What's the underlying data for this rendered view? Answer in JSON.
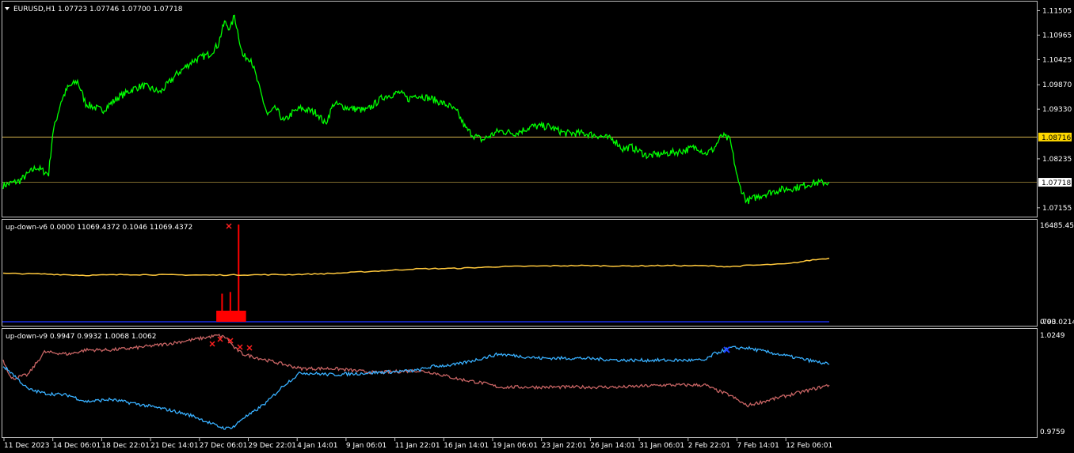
{
  "colors": {
    "background": "#000000",
    "frame": "#c0c0c0",
    "price": "#00ff00",
    "hline": "#d4b24c",
    "v6_line": "#ffc83c",
    "v6_hist": "#ff0000",
    "v6_base": "#1a2ee6",
    "v9_up": "#38b0ff",
    "v9_down": "#c86464",
    "marker_red": "#ff2020",
    "marker_blue": "#2040ff",
    "price_tag_bg": "#ffd800"
  },
  "main_panel": {
    "menu_icon": "triangle-down-icon",
    "title": "EURUSD,H1  1.07723 1.07746 1.07700 1.07718",
    "y_ticks": [
      "1.11505",
      "1.10965",
      "1.10425",
      "1.09870",
      "1.09330",
      "1.08716",
      "1.08235",
      "1.07718",
      "1.07155"
    ],
    "y_tick_values": [
      1.11505,
      1.10965,
      1.10425,
      1.0987,
      1.0933,
      1.08716,
      1.08235,
      1.07718,
      1.07155
    ],
    "hline_level_label": "1.08716",
    "hline_level": 1.08716,
    "current_price_label": "1.07718",
    "current_price": 1.07718
  },
  "panel_v6": {
    "title": "up-down-v6 0.0000 11069.4372 0.1046 11069.4372",
    "y_top": "16485.450",
    "y_bottom_a": "0.00",
    "y_bottom_b": "-793.0214"
  },
  "panel_v9": {
    "title": "up-down-v9 0.9947 0.9932 1.0068 1.0062",
    "y_top": "1.0249",
    "y_bottom": "0.9759"
  },
  "x_axis": {
    "labels": [
      "11 Dec 2023",
      "14 Dec 06:01",
      "18 Dec 22:01",
      "21 Dec 14:01",
      "27 Dec 06:01",
      "29 Dec 22:01",
      "4 Jan 14:01",
      "9 Jan 06:01",
      "11 Jan 22:01",
      "16 Jan 14:01",
      "19 Jan 06:01",
      "23 Jan 22:01",
      "26 Jan 14:01",
      "31 Jan 06:01",
      "2 Feb 22:01",
      "7 Feb 14:01",
      "12 Feb 06:01"
    ]
  },
  "chart_data": [
    {
      "type": "line",
      "title": "EURUSD,H1  1.07723 1.07746 1.07700 1.07718",
      "ylim": [
        1.0703,
        1.116
      ],
      "x": [
        0,
        0.02,
        0.04,
        0.055,
        0.06,
        0.07,
        0.078,
        0.09,
        0.1,
        0.12,
        0.14,
        0.16,
        0.17,
        0.19,
        0.21,
        0.23,
        0.25,
        0.26,
        0.268,
        0.275,
        0.28,
        0.29,
        0.3,
        0.31,
        0.32,
        0.33,
        0.34,
        0.35,
        0.36,
        0.38,
        0.39,
        0.4,
        0.42,
        0.44,
        0.46,
        0.48,
        0.49,
        0.5,
        0.52,
        0.54,
        0.55,
        0.56,
        0.57,
        0.58,
        0.6,
        0.62,
        0.64,
        0.66,
        0.68,
        0.7,
        0.72,
        0.74,
        0.75,
        0.76,
        0.78,
        0.8,
        0.82,
        0.84,
        0.85,
        0.86,
        0.87,
        0.88,
        0.89,
        0.9,
        0.92,
        0.94,
        0.96,
        0.98,
        1.0
      ],
      "values": [
        1.0765,
        1.0775,
        1.0805,
        1.079,
        1.088,
        1.095,
        1.098,
        1.0995,
        1.0945,
        1.093,
        1.096,
        1.098,
        1.0985,
        1.097,
        1.101,
        1.104,
        1.1055,
        1.1075,
        1.1125,
        1.111,
        1.114,
        1.105,
        1.1045,
        1.098,
        1.092,
        1.0935,
        1.0905,
        1.0925,
        1.0935,
        1.0925,
        1.09,
        1.0945,
        1.0935,
        1.093,
        1.096,
        1.097,
        1.0955,
        1.0965,
        1.0955,
        1.094,
        1.0925,
        1.089,
        1.0875,
        1.0865,
        1.0885,
        1.088,
        1.0895,
        1.0895,
        1.088,
        1.088,
        1.0875,
        1.0865,
        1.0845,
        1.085,
        1.083,
        1.0835,
        1.084,
        1.085,
        1.0835,
        1.0845,
        1.0875,
        1.0865,
        1.077,
        1.073,
        1.0745,
        1.0755,
        1.076,
        1.077,
        1.0772
      ]
    },
    {
      "type": "line",
      "title": "up-down-v6 0.0000 11069.4372 0.1046 11069.4372",
      "ylim": [
        -793.0214,
        16485.45
      ],
      "x": [
        0,
        0.05,
        0.1,
        0.15,
        0.2,
        0.25,
        0.3,
        0.35,
        0.4,
        0.45,
        0.5,
        0.55,
        0.6,
        0.65,
        0.7,
        0.75,
        0.8,
        0.85,
        0.88,
        0.9,
        0.95,
        0.98,
        1.0
      ],
      "values": [
        7800,
        7700,
        7450,
        7600,
        7550,
        7500,
        7550,
        7600,
        7800,
        8200,
        8600,
        8700,
        9000,
        9100,
        9200,
        9100,
        9200,
        9150,
        9000,
        9200,
        9500,
        10200,
        10500
      ],
      "histogram": {
        "x": [
          0.26,
          0.265,
          0.27,
          0.275,
          0.28,
          0.285,
          0.29
        ],
        "values": [
          400,
          4200,
          600,
          4500,
          800,
          16485,
          500
        ]
      }
    },
    {
      "type": "line",
      "title": "up-down-v9 0.9947 0.9932 1.0068 1.0062",
      "ylim": [
        0.9759,
        1.0249
      ],
      "x": [
        0,
        0.01,
        0.03,
        0.05,
        0.08,
        0.1,
        0.13,
        0.16,
        0.2,
        0.23,
        0.26,
        0.27,
        0.28,
        0.29,
        0.3,
        0.32,
        0.34,
        0.36,
        0.4,
        0.45,
        0.5,
        0.52,
        0.55,
        0.58,
        0.6,
        0.65,
        0.7,
        0.75,
        0.8,
        0.85,
        0.86,
        0.88,
        0.9,
        0.95,
        1.0
      ],
      "series": [
        {
          "name": "",
          "values": [
            1.012,
            1.003,
            1.005,
            1.016,
            1.015,
            1.017,
            1.017,
            1.018,
            1.02,
            1.022,
            1.024,
            1.023,
            1.018,
            1.015,
            1.014,
            1.012,
            1.01,
            1.008,
            1.008,
            1.006,
            1.007,
            1.006,
            1.003,
            1.001,
            0.999,
            0.999,
            0.999,
            0.999,
            1.0,
            1.0,
            0.998,
            0.995,
            0.99,
            0.995,
            1.0
          ]
        },
        {
          "name": "",
          "values": [
            1.009,
            1.006,
            0.998,
            0.996,
            0.995,
            0.992,
            0.993,
            0.991,
            0.988,
            0.985,
            0.98,
            0.979,
            0.98,
            0.984,
            0.986,
            0.992,
            1.0,
            1.006,
            1.005,
            1.006,
            1.007,
            1.009,
            1.01,
            1.013,
            1.015,
            1.013,
            1.013,
            1.012,
            1.012,
            1.012,
            1.015,
            1.018,
            1.018,
            1.014,
            1.01
          ]
        }
      ]
    }
  ]
}
